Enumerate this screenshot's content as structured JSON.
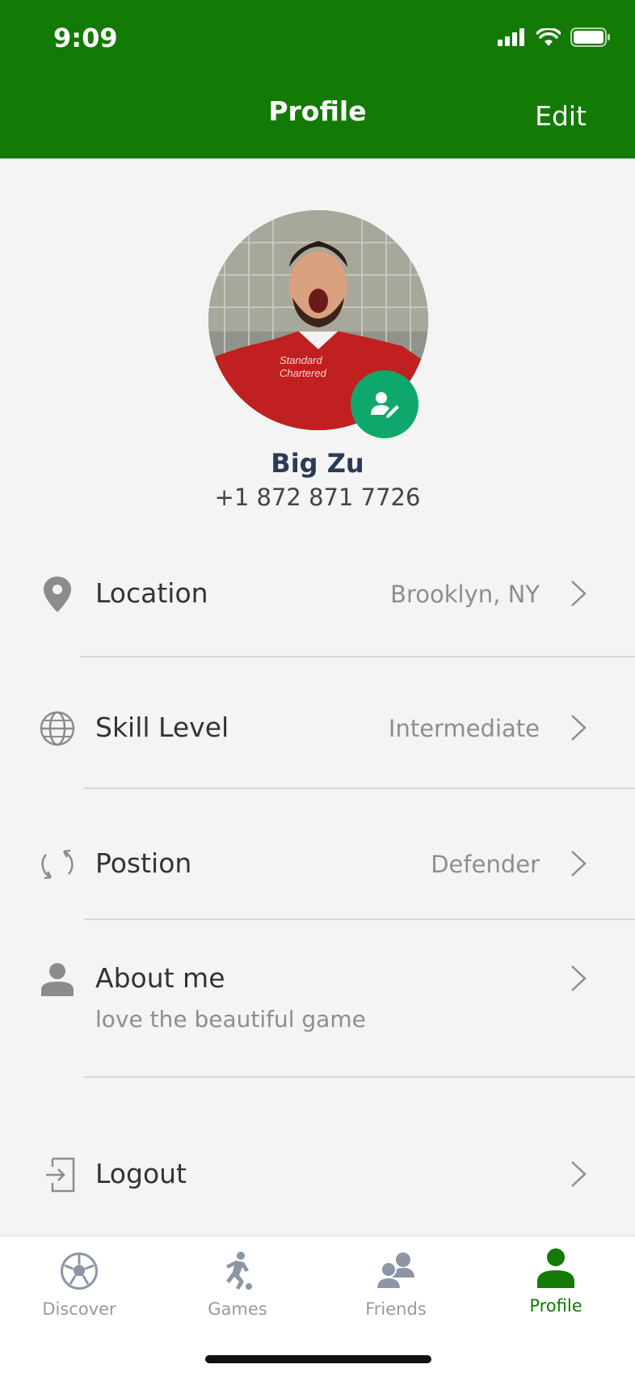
{
  "status_bar": {
    "time": "9:09"
  },
  "nav": {
    "title": "Profile",
    "edit_label": "Edit"
  },
  "profile": {
    "name": "Big Zu",
    "phone": "+1 872 871 7726",
    "shirt_text_1": "Standard",
    "shirt_text_2": "Chartered"
  },
  "rows": [
    {
      "label": "Location",
      "value": "Brooklyn, NY",
      "icon": "map-pin-icon"
    },
    {
      "label": "Skill Level",
      "value": "Intermediate",
      "icon": "globe-icon"
    },
    {
      "label": "Postion",
      "value": "Defender",
      "icon": "refresh-icon"
    },
    {
      "label": "About me",
      "subtext": "love the beautiful game",
      "icon": "person-icon"
    },
    {
      "label": "Logout",
      "icon": "logout-icon"
    }
  ],
  "tabs": [
    {
      "label": "Discover",
      "icon": "soccer-ball-icon",
      "active": false
    },
    {
      "label": "Games",
      "icon": "player-kick-icon",
      "active": false
    },
    {
      "label": "Friends",
      "icon": "friends-icon",
      "active": false
    },
    {
      "label": "Profile",
      "icon": "profile-icon",
      "active": true
    }
  ],
  "colors": {
    "header": "#137a05",
    "accent_green": "#0fa86c",
    "active_tab": "#137a05"
  }
}
